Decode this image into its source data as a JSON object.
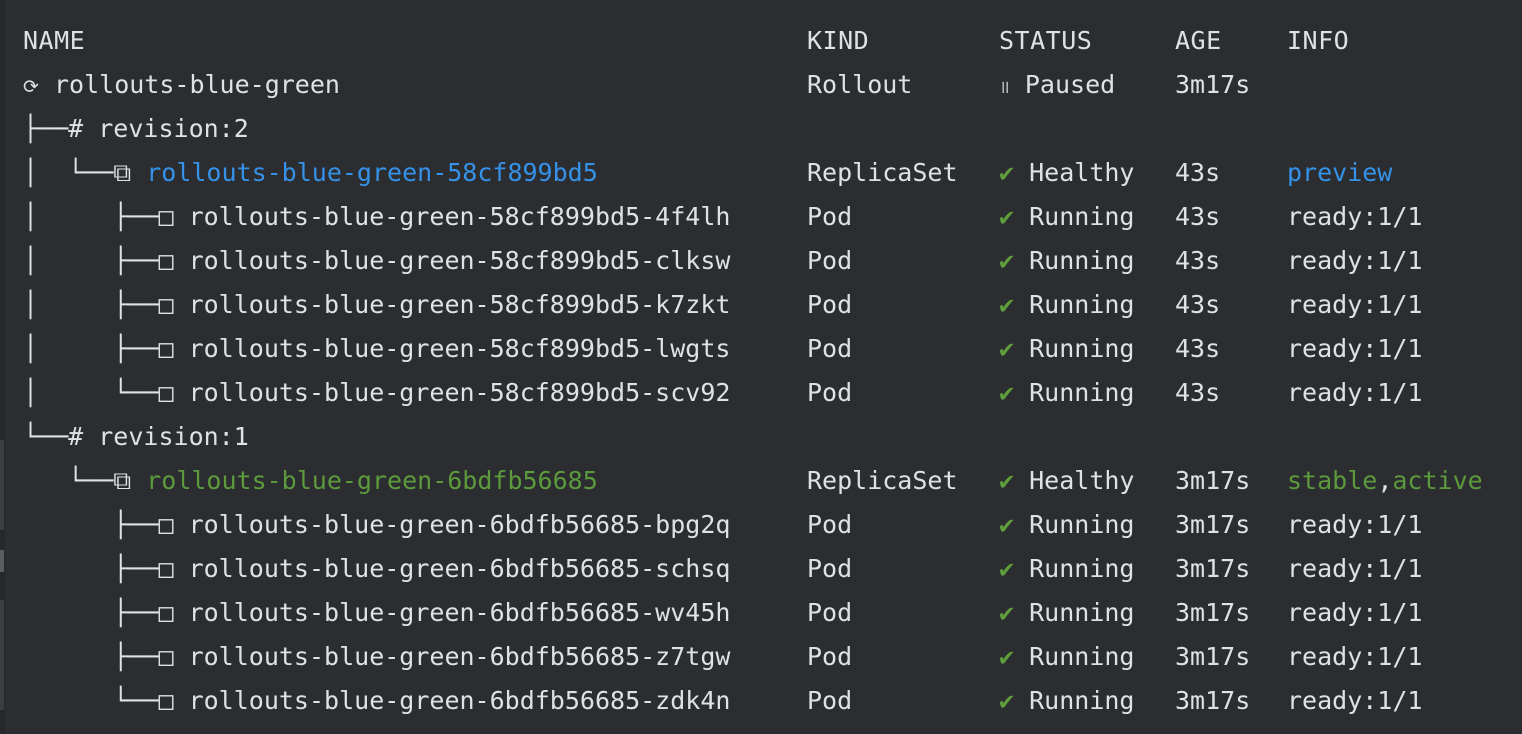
{
  "headers": {
    "name": "NAME",
    "kind": "KIND",
    "status": "STATUS",
    "age": "AGE",
    "info": "INFO"
  },
  "rollout": {
    "icon": "⟳",
    "name": "rollouts-blue-green",
    "kind": "Rollout",
    "status_icon": "॥",
    "status": "Paused",
    "age": "3m17s"
  },
  "revisions": [
    {
      "prefix": "├──",
      "label": "# revision:2",
      "replicaset": {
        "prefix": "│  └──⧉ ",
        "name": "rollouts-blue-green-58cf899bd5",
        "kind": "ReplicaSet",
        "status_icon": "✔",
        "status": "Healthy",
        "age": "43s",
        "info": "preview",
        "color": "#3592e8"
      },
      "pods": [
        {
          "prefix": "│     ├──□ ",
          "name": "rollouts-blue-green-58cf899bd5-4f4lh",
          "kind": "Pod",
          "status_icon": "✔",
          "status": "Running",
          "age": "43s",
          "info": "ready:1/1"
        },
        {
          "prefix": "│     ├──□ ",
          "name": "rollouts-blue-green-58cf899bd5-clksw",
          "kind": "Pod",
          "status_icon": "✔",
          "status": "Running",
          "age": "43s",
          "info": "ready:1/1"
        },
        {
          "prefix": "│     ├──□ ",
          "name": "rollouts-blue-green-58cf899bd5-k7zkt",
          "kind": "Pod",
          "status_icon": "✔",
          "status": "Running",
          "age": "43s",
          "info": "ready:1/1"
        },
        {
          "prefix": "│     ├──□ ",
          "name": "rollouts-blue-green-58cf899bd5-lwgts",
          "kind": "Pod",
          "status_icon": "✔",
          "status": "Running",
          "age": "43s",
          "info": "ready:1/1"
        },
        {
          "prefix": "│     └──□ ",
          "name": "rollouts-blue-green-58cf899bd5-scv92",
          "kind": "Pod",
          "status_icon": "✔",
          "status": "Running",
          "age": "43s",
          "info": "ready:1/1"
        }
      ]
    },
    {
      "prefix": "└──",
      "label": "# revision:1",
      "replicaset": {
        "prefix": "   └──⧉ ",
        "name": "rollouts-blue-green-6bdfb56685",
        "kind": "ReplicaSet",
        "status_icon": "✔",
        "status": "Healthy",
        "age": "3m17s",
        "info_parts": [
          "stable",
          ",",
          "active"
        ],
        "color": "#5c9a3c"
      },
      "pods": [
        {
          "prefix": "      ├──□ ",
          "name": "rollouts-blue-green-6bdfb56685-bpg2q",
          "kind": "Pod",
          "status_icon": "✔",
          "status": "Running",
          "age": "3m17s",
          "info": "ready:1/1"
        },
        {
          "prefix": "      ├──□ ",
          "name": "rollouts-blue-green-6bdfb56685-schsq",
          "kind": "Pod",
          "status_icon": "✔",
          "status": "Running",
          "age": "3m17s",
          "info": "ready:1/1"
        },
        {
          "prefix": "      ├──□ ",
          "name": "rollouts-blue-green-6bdfb56685-wv45h",
          "kind": "Pod",
          "status_icon": "✔",
          "status": "Running",
          "age": "3m17s",
          "info": "ready:1/1"
        },
        {
          "prefix": "      ├──□ ",
          "name": "rollouts-blue-green-6bdfb56685-z7tgw",
          "kind": "Pod",
          "status_icon": "✔",
          "status": "Running",
          "age": "3m17s",
          "info": "ready:1/1"
        },
        {
          "prefix": "      └──□ ",
          "name": "rollouts-blue-green-6bdfb56685-zdk4n",
          "kind": "Pod",
          "status_icon": "✔",
          "status": "Running",
          "age": "3m17s",
          "info": "ready:1/1"
        }
      ]
    }
  ]
}
